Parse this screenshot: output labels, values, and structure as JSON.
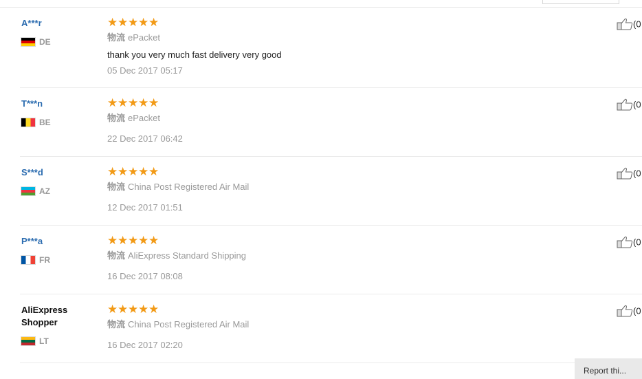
{
  "shipping_label": "物流",
  "reviews": [
    {
      "user": "A***r",
      "country": "DE",
      "stars": "★★★★★",
      "shipping": "ePacket",
      "text": "thank you very much fast delivery very good",
      "date": "05 Dec 2017 05:17",
      "helpful": "(0"
    },
    {
      "user": "T***n",
      "country": "BE",
      "stars": "★★★★★",
      "shipping": "ePacket",
      "text": "",
      "date": "22 Dec 2017 06:42",
      "helpful": "(0"
    },
    {
      "user": "S***d",
      "country": "AZ",
      "stars": "★★★★★",
      "shipping": "China Post Registered Air Mail",
      "text": "",
      "date": "12 Dec 2017 01:51",
      "helpful": "(0"
    },
    {
      "user": "P***a",
      "country": "FR",
      "stars": "★★★★★",
      "shipping": "AliExpress Standard Shipping",
      "text": "",
      "date": "16 Dec 2017 08:08",
      "helpful": "(0"
    },
    {
      "user": "AliExpress Shopper",
      "country": "LT",
      "stars": "★★★★★",
      "shipping": "China Post Registered Air Mail",
      "text": "",
      "date": "16 Dec 2017 02:20",
      "helpful": "(0"
    }
  ],
  "flags": {
    "DE": [
      "#000000",
      "#dd0000",
      "#ffce00"
    ],
    "BE": [
      "#000000",
      "#fdda24",
      "#ef3340"
    ],
    "AZ": [
      "#00b5e2",
      "#ef3340",
      "#509e2f"
    ],
    "FR": [
      "#0055a4",
      "#ffffff",
      "#ef4135"
    ],
    "LT": [
      "#fdb913",
      "#006a44",
      "#c1272d"
    ]
  },
  "colors": {
    "star": "#f29a16",
    "username": "#2b6cb0",
    "muted": "#999999"
  },
  "footer_button": "Report thi..."
}
